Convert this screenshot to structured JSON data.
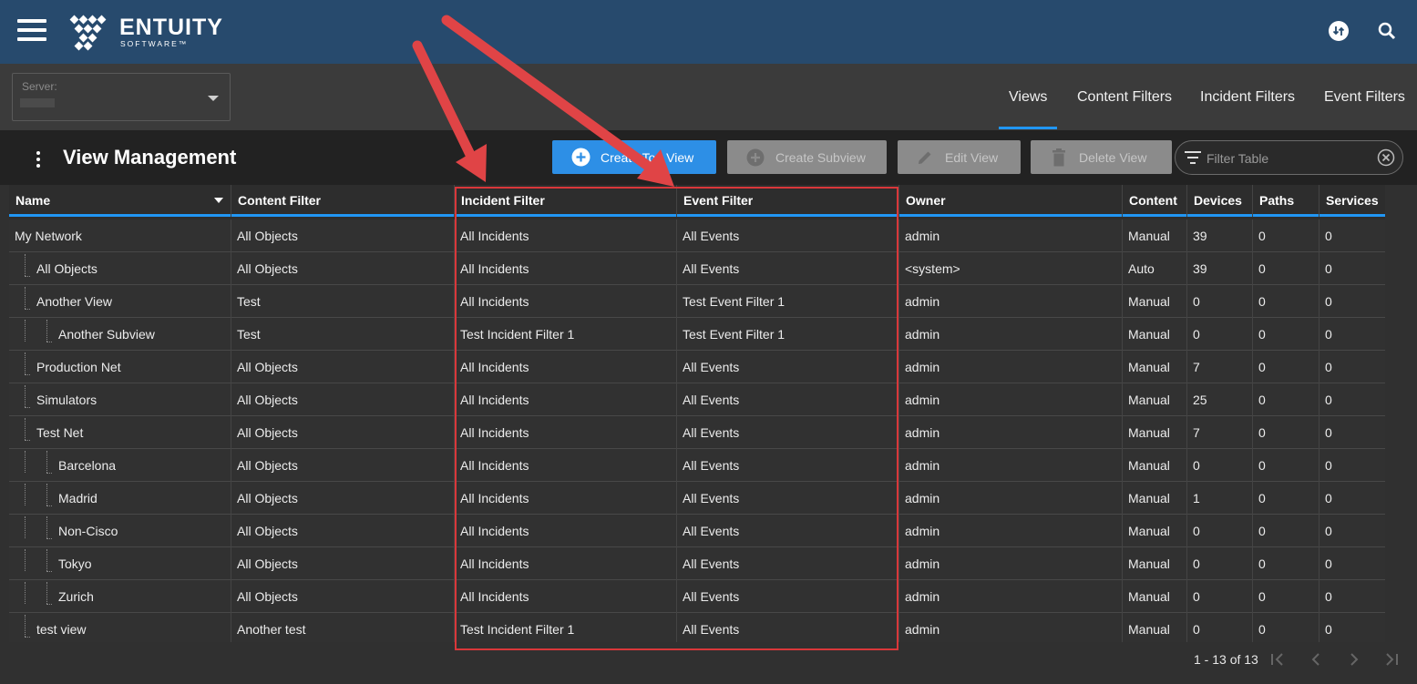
{
  "brand": {
    "name": "ENTUITY",
    "sub": "SOFTWARE™"
  },
  "icons": {
    "menu": "hamburger-icon",
    "sync": "sync-icon",
    "search": "search-icon",
    "kebab": "more-vert-icon",
    "filter": "filter-icon",
    "clear": "clear-icon"
  },
  "server": {
    "label": "Server:"
  },
  "nav": {
    "tabs": [
      "Views",
      "Content Filters",
      "Incident Filters",
      "Event Filters"
    ],
    "active": "Views"
  },
  "page": {
    "title": "View Management"
  },
  "toolbar": {
    "create_top": "Create Top View",
    "create_sub": "Create Subview",
    "edit": "Edit View",
    "delete": "Delete View",
    "filter_placeholder": "Filter Table"
  },
  "colors": {
    "header_bg": "#274a6d",
    "accent": "#2196f3",
    "primary_btn": "#2d8fe6",
    "callout": "#d9373a"
  },
  "table": {
    "columns": [
      "Name",
      "Content Filter",
      "Incident Filter",
      "Event Filter",
      "Owner",
      "Content",
      "Devices",
      "Paths",
      "Services"
    ],
    "rows": [
      {
        "name": "My Network",
        "level": 0,
        "content_filter": "All Objects",
        "incident_filter": "All Incidents",
        "event_filter": "All Events",
        "owner": "admin",
        "content": "Manual",
        "devices": "39",
        "paths": "0",
        "services": "0"
      },
      {
        "name": "All Objects",
        "level": 1,
        "content_filter": "All Objects",
        "incident_filter": "All Incidents",
        "event_filter": "All Events",
        "owner": "<system>",
        "content": "Auto",
        "devices": "39",
        "paths": "0",
        "services": "0"
      },
      {
        "name": "Another View",
        "level": 1,
        "content_filter": "Test",
        "incident_filter": "All Incidents",
        "event_filter": "Test Event Filter 1",
        "owner": "admin",
        "content": "Manual",
        "devices": "0",
        "paths": "0",
        "services": "0"
      },
      {
        "name": "Another Subview",
        "level": 2,
        "content_filter": "Test",
        "incident_filter": "Test Incident Filter 1",
        "event_filter": "Test Event Filter 1",
        "owner": "admin",
        "content": "Manual",
        "devices": "0",
        "paths": "0",
        "services": "0"
      },
      {
        "name": "Production Net",
        "level": 1,
        "content_filter": "All Objects",
        "incident_filter": "All Incidents",
        "event_filter": "All Events",
        "owner": "admin",
        "content": "Manual",
        "devices": "7",
        "paths": "0",
        "services": "0"
      },
      {
        "name": "Simulators",
        "level": 1,
        "content_filter": "All Objects",
        "incident_filter": "All Incidents",
        "event_filter": "All Events",
        "owner": "admin",
        "content": "Manual",
        "devices": "25",
        "paths": "0",
        "services": "0"
      },
      {
        "name": "Test Net",
        "level": 1,
        "content_filter": "All Objects",
        "incident_filter": "All Incidents",
        "event_filter": "All Events",
        "owner": "admin",
        "content": "Manual",
        "devices": "7",
        "paths": "0",
        "services": "0"
      },
      {
        "name": "Barcelona",
        "level": 2,
        "content_filter": "All Objects",
        "incident_filter": "All Incidents",
        "event_filter": "All Events",
        "owner": "admin",
        "content": "Manual",
        "devices": "0",
        "paths": "0",
        "services": "0"
      },
      {
        "name": "Madrid",
        "level": 2,
        "content_filter": "All Objects",
        "incident_filter": "All Incidents",
        "event_filter": "All Events",
        "owner": "admin",
        "content": "Manual",
        "devices": "1",
        "paths": "0",
        "services": "0"
      },
      {
        "name": "Non-Cisco",
        "level": 2,
        "content_filter": "All Objects",
        "incident_filter": "All Incidents",
        "event_filter": "All Events",
        "owner": "admin",
        "content": "Manual",
        "devices": "0",
        "paths": "0",
        "services": "0"
      },
      {
        "name": "Tokyo",
        "level": 2,
        "content_filter": "All Objects",
        "incident_filter": "All Incidents",
        "event_filter": "All Events",
        "owner": "admin",
        "content": "Manual",
        "devices": "0",
        "paths": "0",
        "services": "0"
      },
      {
        "name": "Zurich",
        "level": 2,
        "content_filter": "All Objects",
        "incident_filter": "All Incidents",
        "event_filter": "All Events",
        "owner": "admin",
        "content": "Manual",
        "devices": "0",
        "paths": "0",
        "services": "0"
      },
      {
        "name": "test view",
        "level": 1,
        "content_filter": "Another test",
        "incident_filter": "Test Incident Filter 1",
        "event_filter": "All Events",
        "owner": "admin",
        "content": "Manual",
        "devices": "0",
        "paths": "0",
        "services": "0"
      }
    ]
  },
  "pagination": {
    "range": "1 - 13 of 13"
  }
}
